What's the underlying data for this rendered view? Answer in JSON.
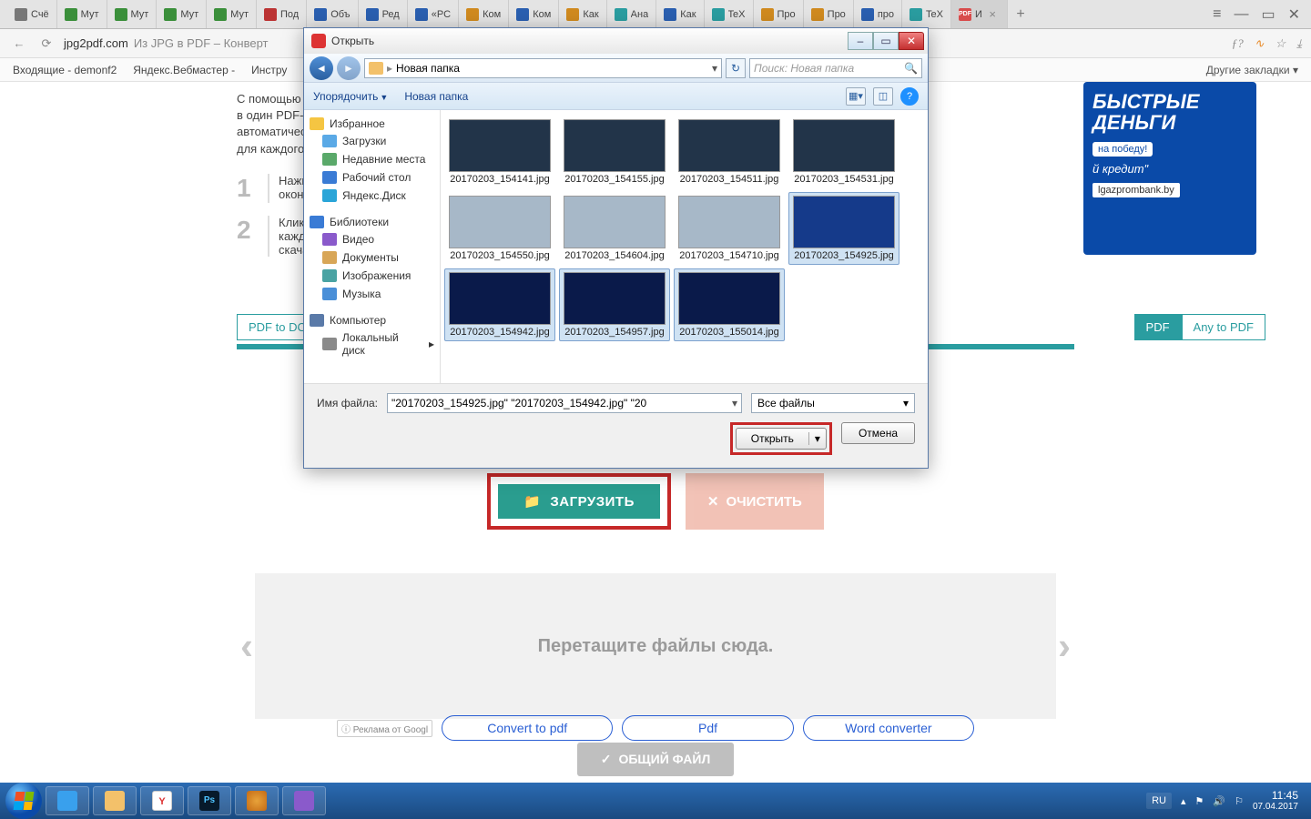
{
  "tabs": [
    {
      "label": "Счё",
      "cls": ""
    },
    {
      "label": "Мут",
      "cls": "green"
    },
    {
      "label": "Мут",
      "cls": "green"
    },
    {
      "label": "Мут",
      "cls": "green"
    },
    {
      "label": "Мут",
      "cls": "green"
    },
    {
      "label": "Под",
      "cls": "red"
    },
    {
      "label": "Объ",
      "cls": "blue"
    },
    {
      "label": "Ред",
      "cls": "blue"
    },
    {
      "label": "«PC",
      "cls": "blue"
    },
    {
      "label": "Ком",
      "cls": "orange"
    },
    {
      "label": "Ком",
      "cls": "blue"
    },
    {
      "label": "Как",
      "cls": "orange"
    },
    {
      "label": "Ана",
      "cls": "teal"
    },
    {
      "label": "Как",
      "cls": "blue"
    },
    {
      "label": "TeX",
      "cls": "teal"
    },
    {
      "label": "Про",
      "cls": "orange"
    },
    {
      "label": "Про",
      "cls": "orange"
    },
    {
      "label": "про",
      "cls": "blue"
    },
    {
      "label": "TeX",
      "cls": "teal"
    },
    {
      "label": "И",
      "cls": "pdf",
      "active": true,
      "closable": true,
      "favtext": "JPG\nPDF"
    }
  ],
  "address": {
    "host": "jpg2pdf.com",
    "title": "Из JPG в PDF – Конверт"
  },
  "bookmarks": {
    "b1": "Входящие - demonf2",
    "b2": "Яндекс.Вебмастер -",
    "b3": "Инстру",
    "right": "Другие закладки"
  },
  "page": {
    "intro": "С помощью эт\nв один PDF-фа\nавтоматическ\nдля каждого и",
    "step1": "Нажмите\nокончания",
    "step2": "Кликая на\nкаждого и\nскачать од",
    "tab_left": "PDF to DOC",
    "tab_r1": "PDF",
    "tab_r2": "Any to PDF",
    "ad_big": "БЫСТРЫЕ\nДЕНЬГИ",
    "ad_tag": "на победу!",
    "ad_sub": "й кредит\"",
    "ad_link": "lgazprombank.by",
    "btn_upload": "ЗАГРУЗИТЬ",
    "btn_clear": "ОЧИСТИТЬ",
    "dropzone": "Перетащите файлы сюда.",
    "btn_combined": "ОБЩИЙ ФАЙЛ",
    "gad": "Реклама от Googl",
    "pills": [
      "Convert to pdf",
      "Pdf",
      "Word converter"
    ]
  },
  "taskbar": {
    "lang": "RU",
    "time": "11:45",
    "date": "07.04.2017"
  },
  "dialog": {
    "title": "Открыть",
    "crumb": "Новая папка",
    "search_placeholder": "Поиск: Новая папка",
    "tb_organize": "Упорядочить",
    "tb_newfolder": "Новая папка",
    "side": {
      "fav": "Избранное",
      "dl": "Загрузки",
      "recent": "Недавние места",
      "desk": "Рабочий стол",
      "yd": "Яндекс.Диск",
      "libs": "Библиотеки",
      "vid": "Видео",
      "doc": "Документы",
      "img": "Изображения",
      "mus": "Музыка",
      "comp": "Компьютер",
      "drive": "Локальный диск"
    },
    "files": [
      {
        "name": "20170203_154141.jpg",
        "thumb": "dark"
      },
      {
        "name": "20170203_154155.jpg",
        "thumb": "dark"
      },
      {
        "name": "20170203_154511.jpg",
        "thumb": "dark"
      },
      {
        "name": "20170203_154531.jpg",
        "thumb": "dark"
      },
      {
        "name": "20170203_154550.jpg",
        "thumb": "light"
      },
      {
        "name": "20170203_154604.jpg",
        "thumb": "light"
      },
      {
        "name": "20170203_154710.jpg",
        "thumb": "light"
      },
      {
        "name": "20170203_154925.jpg",
        "thumb": "blue",
        "selected": true
      },
      {
        "name": "20170203_154942.jpg",
        "thumb": "bios",
        "selected": true
      },
      {
        "name": "20170203_154957.jpg",
        "thumb": "bios",
        "selected": true
      },
      {
        "name": "20170203_155014.jpg",
        "thumb": "bios",
        "selected": true
      }
    ],
    "fn_label": "Имя файла:",
    "fn_value": "\"20170203_154925.jpg\" \"20170203_154942.jpg\" \"20",
    "filter": "Все файлы",
    "open": "Открыть",
    "cancel": "Отмена"
  }
}
